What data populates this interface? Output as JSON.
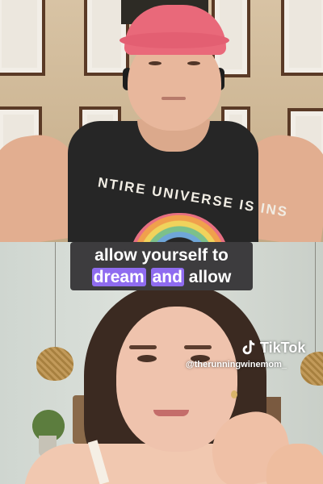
{
  "caption": {
    "line1": "allow yourself to",
    "line2_highlight1": "dream",
    "line2_highlight2": "and",
    "line2_rest": "allow",
    "highlight_color": "#8f6cf0"
  },
  "watermark": {
    "brand": "TikTok",
    "handle": "@therunningwinemom_",
    "icon": "tiktok-logo-icon"
  },
  "top_video": {
    "shirt_print": "NTIRE UNIVERSE IS INS"
  }
}
